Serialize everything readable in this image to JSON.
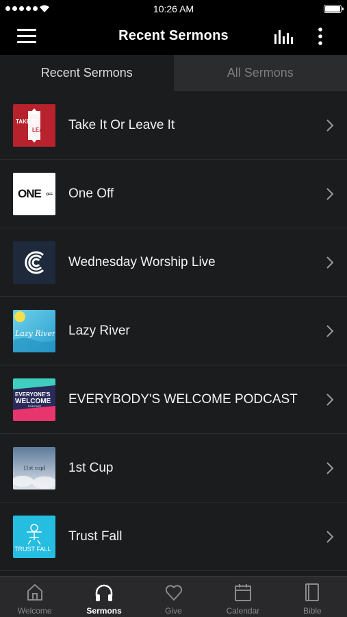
{
  "status_bar": {
    "time": "10:26 AM"
  },
  "header": {
    "title": "Recent Sermons",
    "menu_icon": "hamburger-menu-icon",
    "bars_icon": "audio-bars-icon",
    "more_icon": "vertical-dots-icon"
  },
  "segments": {
    "recent": "Recent Sermons",
    "all": "All Sermons",
    "selected": "Recent Sermons"
  },
  "sermons": [
    {
      "title": "Take It Or Leave It",
      "art_text": [
        "TAKE IT",
        "LEAVE IT"
      ],
      "art_color": "#b8222c"
    },
    {
      "title": "One Off",
      "art_text": [
        "ONE",
        "OFF"
      ],
      "art_color": "#ffffff"
    },
    {
      "title": "Wednesday Worship Live",
      "art_text": [],
      "art_color": "#1e2a3c"
    },
    {
      "title": "Lazy River",
      "art_text": [
        "Lazy River"
      ],
      "art_color": "#3fb9d9"
    },
    {
      "title": "EVERYBODY'S WELCOME PODCAST",
      "art_text": [
        "EVERYONE'S",
        "WELCOME",
        "PODCAST"
      ],
      "art_color": "#2a2a5a"
    },
    {
      "title": "1st Cup",
      "art_text": [
        "[1st cup]"
      ],
      "art_color": "#9fb2c6"
    },
    {
      "title": "Trust Fall",
      "art_text": [
        "TRUST FALL"
      ],
      "art_color": "#25bde0"
    }
  ],
  "tabs": [
    {
      "label": "Welcome",
      "icon": "home-icon",
      "active": false
    },
    {
      "label": "Sermons",
      "icon": "headphones-icon",
      "active": true
    },
    {
      "label": "Give",
      "icon": "heart-icon",
      "active": false
    },
    {
      "label": "Calendar",
      "icon": "calendar-icon",
      "active": false
    },
    {
      "label": "Bible",
      "icon": "book-icon",
      "active": false
    }
  ]
}
